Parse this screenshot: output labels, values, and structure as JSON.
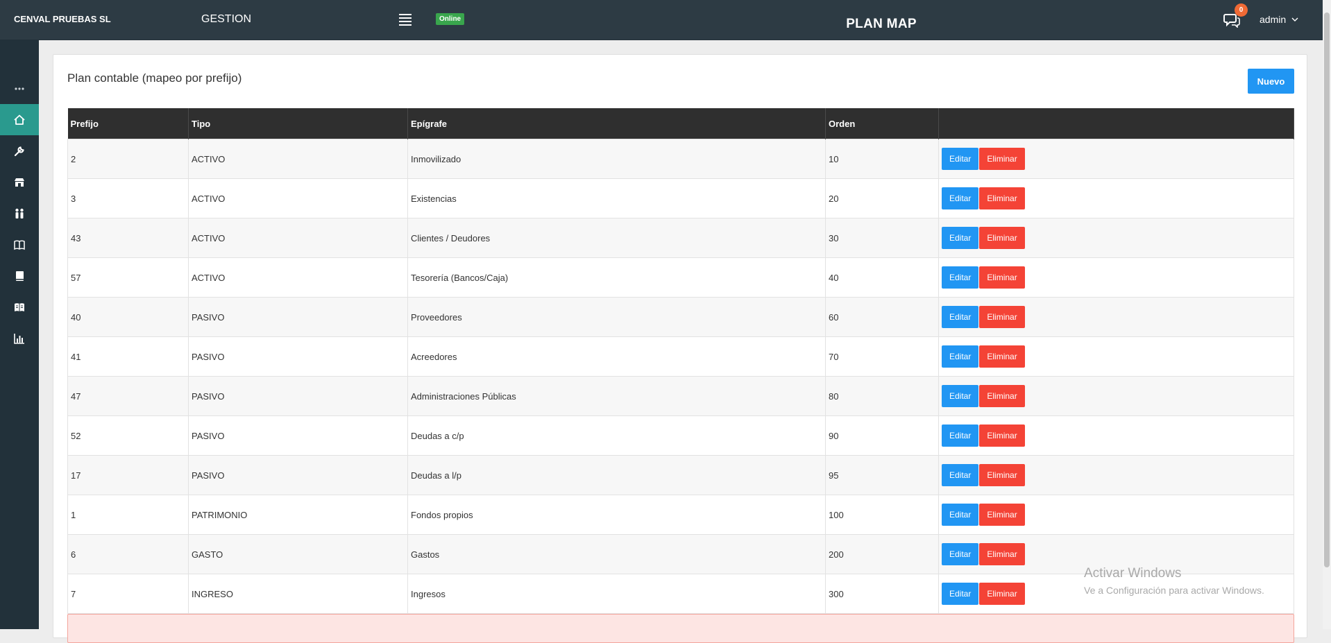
{
  "header": {
    "company": "CENVAL PRUEBAS SL",
    "module": "GESTION",
    "status_badge": "Online",
    "page_title": "PLAN MAP",
    "notifications_count": "0",
    "user": "admin"
  },
  "sidebar": {
    "items": [
      {
        "icon": "more-dots-icon",
        "active": false
      },
      {
        "icon": "home-icon",
        "active": true
      },
      {
        "icon": "wrench-icon",
        "active": false
      },
      {
        "icon": "store-icon",
        "active": false
      },
      {
        "icon": "users-icon",
        "active": false
      },
      {
        "icon": "open-book-icon",
        "active": false
      },
      {
        "icon": "book-icon",
        "active": false
      },
      {
        "icon": "reader-icon",
        "active": false
      },
      {
        "icon": "bar-chart-icon",
        "active": false
      }
    ]
  },
  "panel": {
    "heading": "Plan contable (mapeo por prefijo)",
    "new_button": "Nuevo"
  },
  "table": {
    "columns": [
      "Prefijo",
      "Tipo",
      "Epígrafe",
      "Orden",
      ""
    ],
    "edit_label": "Editar",
    "delete_label": "Eliminar",
    "rows": [
      {
        "prefijo": "2",
        "tipo": "ACTIVO",
        "epigrafe": "Inmovilizado",
        "orden": "10"
      },
      {
        "prefijo": "3",
        "tipo": "ACTIVO",
        "epigrafe": "Existencias",
        "orden": "20"
      },
      {
        "prefijo": "43",
        "tipo": "ACTIVO",
        "epigrafe": "Clientes / Deudores",
        "orden": "30"
      },
      {
        "prefijo": "57",
        "tipo": "ACTIVO",
        "epigrafe": "Tesorería (Bancos/Caja)",
        "orden": "40"
      },
      {
        "prefijo": "40",
        "tipo": "PASIVO",
        "epigrafe": "Proveedores",
        "orden": "60"
      },
      {
        "prefijo": "41",
        "tipo": "PASIVO",
        "epigrafe": "Acreedores",
        "orden": "70"
      },
      {
        "prefijo": "47",
        "tipo": "PASIVO",
        "epigrafe": "Administraciones Públicas",
        "orden": "80"
      },
      {
        "prefijo": "52",
        "tipo": "PASIVO",
        "epigrafe": "Deudas a c/p",
        "orden": "90"
      },
      {
        "prefijo": "17",
        "tipo": "PASIVO",
        "epigrafe": "Deudas a l/p",
        "orden": "95"
      },
      {
        "prefijo": "1",
        "tipo": "PATRIMONIO",
        "epigrafe": "Fondos propios",
        "orden": "100"
      },
      {
        "prefijo": "6",
        "tipo": "GASTO",
        "epigrafe": "Gastos",
        "orden": "200"
      },
      {
        "prefijo": "7",
        "tipo": "INGRESO",
        "epigrafe": "Ingresos",
        "orden": "300"
      }
    ]
  },
  "watermark": {
    "line1": "Activar Windows",
    "line2": "Ve a Configuración para activar Windows."
  },
  "colors": {
    "topbar": "#2d3b44",
    "sidebar": "#22313a",
    "sidebar_active": "#2a9a8e",
    "primary": "#2196f3",
    "danger": "#f44336",
    "online": "#39a64d",
    "badge": "#f06a35"
  }
}
